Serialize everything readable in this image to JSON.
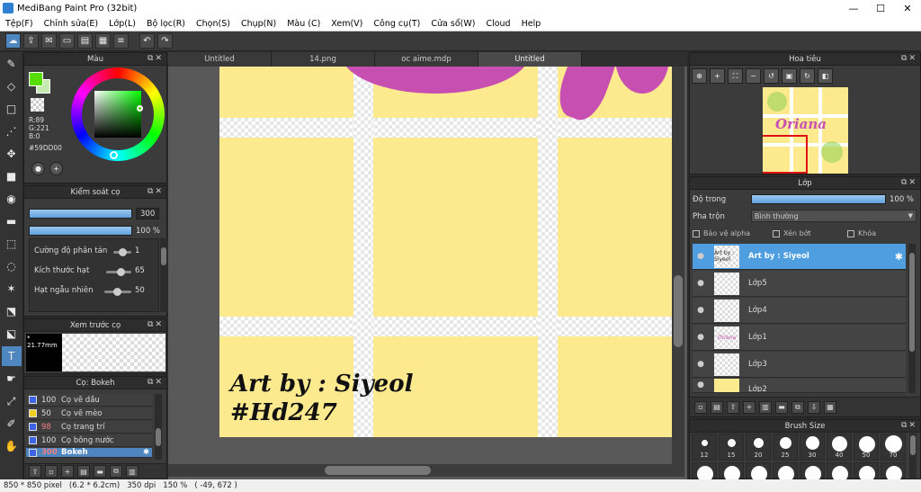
{
  "window": {
    "title": "MediBang Paint Pro (32bit)"
  },
  "menu": [
    "Tệp(F)",
    "Chỉnh sửa(E)",
    "Lớp(L)",
    "Bộ lọc(R)",
    "Chọn(S)",
    "Chụp(N)",
    "Màu (C)",
    "Xem(V)",
    "Công cụ(T)",
    "Cửa sổ(W)",
    "Cloud",
    "Help"
  ],
  "panels": {
    "color": {
      "title": "Màu",
      "r": "R:89",
      "g": "G:221",
      "b": "B:0",
      "hex": "#59DD00",
      "fg_color": "#59dd00",
      "bg_color": "#c6e9b0"
    },
    "brush_control": {
      "title": "Kiểm soát cọ",
      "size_value": "300",
      "opacity_value": "100 %",
      "rows": [
        {
          "label": "Cường độ phân tán",
          "value": "1"
        },
        {
          "label": "Kích thước hạt",
          "value": "65"
        },
        {
          "label": "Hạt ngẫu nhiên",
          "value": "50"
        }
      ]
    },
    "preview": {
      "title": "Xem trước cọ",
      "size": "21.77mm"
    },
    "brushes": {
      "title": "Cọ: Bokeh",
      "items": [
        {
          "size": "100",
          "name": "Cọ vẽ dầu",
          "color": "#3c64e6"
        },
        {
          "size": "50",
          "name": "Cọ vẽ mèo",
          "color": "#f0d020"
        },
        {
          "size": "98",
          "name": "Cọ trang trí",
          "color": "#3c64e6"
        },
        {
          "size": "100",
          "name": "Cọ bông nước",
          "color": "#3c64e6"
        },
        {
          "size": "300",
          "name": "Bokeh",
          "color": "#3c64e6"
        }
      ]
    },
    "navigator": {
      "title": "Hoa tiêu",
      "thumb_text": "Oriana"
    },
    "layers": {
      "title": "Lớp",
      "opacity_label": "Độ trong",
      "opacity_value": "100 %",
      "blend_label": "Pha trộn",
      "blend_value": "Bình thường",
      "checks": [
        "Bảo vệ alpha",
        "Xén bớt",
        "Khóa"
      ],
      "items": [
        "Art by : Siyeol",
        "Lớp5",
        "Lớp4",
        "Lớp1",
        "Lớp3",
        "Lớp2"
      ],
      "thumb_texts": [
        "Art by : Siyeol",
        "Oriana"
      ]
    },
    "brush_size": {
      "title": "Brush Size",
      "sizes": [
        "12",
        "15",
        "20",
        "25",
        "30",
        "40",
        "50",
        "70"
      ]
    }
  },
  "tabs": [
    "Untitled",
    "14.png",
    "oc aime.mdp",
    "Untitled"
  ],
  "canvas": {
    "line1": "Art by : Siyeol",
    "line2": "#Hd247"
  },
  "status": {
    "pixels": "850 * 850 pixel",
    "size": "(6.2 * 6.2cm)",
    "dpi": "350 dpi",
    "zoom": "150 %",
    "coords": "( -49, 672 )"
  }
}
